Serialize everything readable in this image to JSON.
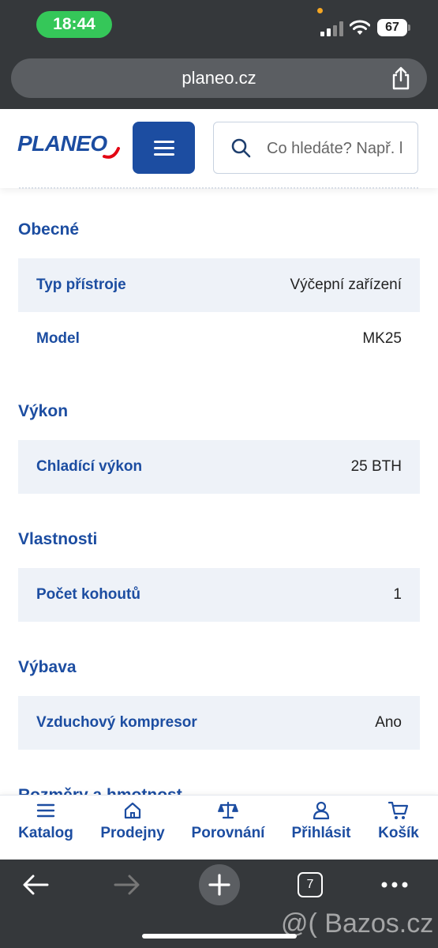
{
  "status": {
    "time": "18:44",
    "battery": "67"
  },
  "browser": {
    "url": "planeo.cz",
    "tab_count": "7"
  },
  "header": {
    "logo": "PLANEO",
    "search_placeholder": "Co hledáte? Např. lednice"
  },
  "sections": [
    {
      "title": "Obecné",
      "rows": [
        {
          "label": "Typ přístroje",
          "value": "Výčepní zařízení"
        },
        {
          "label": "Model",
          "value": "MK25"
        }
      ]
    },
    {
      "title": "Výkon",
      "rows": [
        {
          "label": "Chladící výkon",
          "value": "25 BTH"
        }
      ]
    },
    {
      "title": "Vlastnosti",
      "rows": [
        {
          "label": "Počet kohoutů",
          "value": "1"
        }
      ]
    },
    {
      "title": "Výbava",
      "rows": [
        {
          "label": "Vzduchový kompresor",
          "value": "Ano"
        }
      ]
    },
    {
      "title": "Rozměry a hmotnost"
    }
  ],
  "bottom_nav": [
    {
      "label": "Katalog",
      "icon": "menu-icon"
    },
    {
      "label": "Prodejny",
      "icon": "home-icon"
    },
    {
      "label": "Porovnání",
      "icon": "scales-icon"
    },
    {
      "label": "Přihlásit",
      "icon": "user-icon"
    },
    {
      "label": "Košík",
      "icon": "cart-icon"
    }
  ],
  "watermark": "@( Bazos.cz",
  "colors": {
    "brand": "#1c4da1",
    "accent": "#e30613",
    "row_shade": "#eef2f8",
    "browser_chrome": "#35383b",
    "status_pill": "#35c759"
  }
}
